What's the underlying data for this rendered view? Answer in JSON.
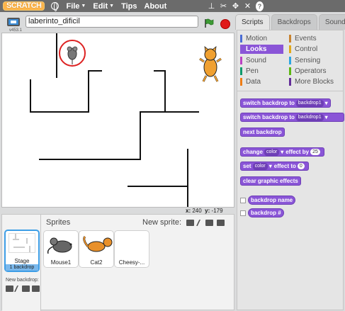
{
  "menubar": {
    "logo_text": "SCRATCH",
    "file": "File",
    "edit": "Edit",
    "tips": "Tips",
    "about": "About"
  },
  "stage_header": {
    "version": "v453.1",
    "project_title": "laberinto_dificil"
  },
  "stage_status": {
    "x_label": "x:",
    "x_value": "240",
    "y_label": "y:",
    "y_value": "-179"
  },
  "sprites_panel": {
    "header": "Sprites",
    "new_sprite": "New sprite:",
    "stage_label": "Stage",
    "stage_sub": "1 backdrop",
    "new_backdrop": "New backdrop:",
    "sprites": [
      {
        "name": "Mouse1"
      },
      {
        "name": "Cat2"
      },
      {
        "name": "Cheesy-..."
      }
    ]
  },
  "tabs": {
    "scripts": "Scripts",
    "backdrops": "Backdrops",
    "sounds": "Sounds"
  },
  "categories": {
    "motion": "Motion",
    "looks": "Looks",
    "sound": "Sound",
    "pen": "Pen",
    "data": "Data",
    "events": "Events",
    "control": "Control",
    "sensing": "Sensing",
    "operators": "Operators",
    "more_blocks": "More Blocks"
  },
  "category_colors": {
    "motion": "#4a6cd4",
    "looks": "#8a55d7",
    "sound": "#bb42c3",
    "pen": "#0e9a6c",
    "data": "#ee7d16",
    "events": "#c88330",
    "control": "#e1a91a",
    "sensing": "#2ca5e2",
    "operators": "#5cb712",
    "more_blocks": "#632d99"
  },
  "blocks": {
    "switch1_text": "switch backdrop to",
    "switch1_value": "backdrop1",
    "switch2_text": "switch backdrop to",
    "switch2_value": "backdrop1",
    "next_backdrop": "next backdrop",
    "change_pre": "change",
    "change_effect": "color",
    "change_mid": "effect by",
    "change_value": "25",
    "set_pre": "set",
    "set_effect": "color",
    "set_mid": "effect to",
    "set_value": "0",
    "clear_effects": "clear graphic effects",
    "reporter_name": "backdrop name",
    "reporter_num": "backdrop #"
  }
}
